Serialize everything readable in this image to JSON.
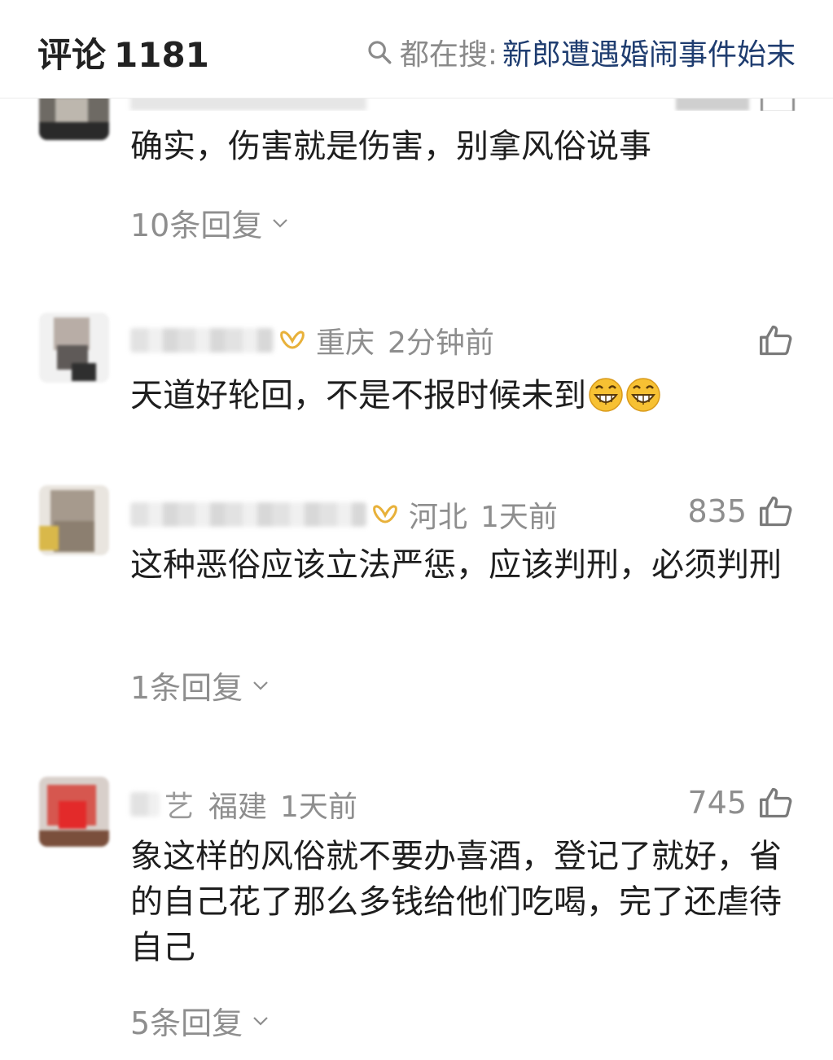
{
  "header": {
    "title": "评论",
    "count": "1181",
    "hot_search_label": "都在搜:",
    "hot_search_topic": "新郎遭遇婚闹事件始末"
  },
  "comments": [
    {
      "text": "确实，伤害就是伤害，别拿风俗说事",
      "replies": "10条回复",
      "partially_hidden": true
    },
    {
      "location": "重庆",
      "time": "2分钟前",
      "text": "天道好轮回，不是不报时候未到",
      "emojis": [
        "grin-emoji",
        "grin-emoji"
      ]
    },
    {
      "location": "河北",
      "time": "1天前",
      "likes": "835",
      "text": "这种恶俗应该立法严惩，应该判刑，必须判刑",
      "replies": "1条回复"
    },
    {
      "name_partial": "艺",
      "location": "福建",
      "time": "1天前",
      "likes": "745",
      "text": "象这样的风俗就不要办喜酒，登记了就好，省的自己花了那么多钱给他们吃喝，完了还虐待自己",
      "replies": "5条回复"
    }
  ],
  "colors": {
    "accent_topic": "#1f3d70",
    "meta_gray": "#8e8e8e",
    "vip_gold": "#e8b13a"
  }
}
